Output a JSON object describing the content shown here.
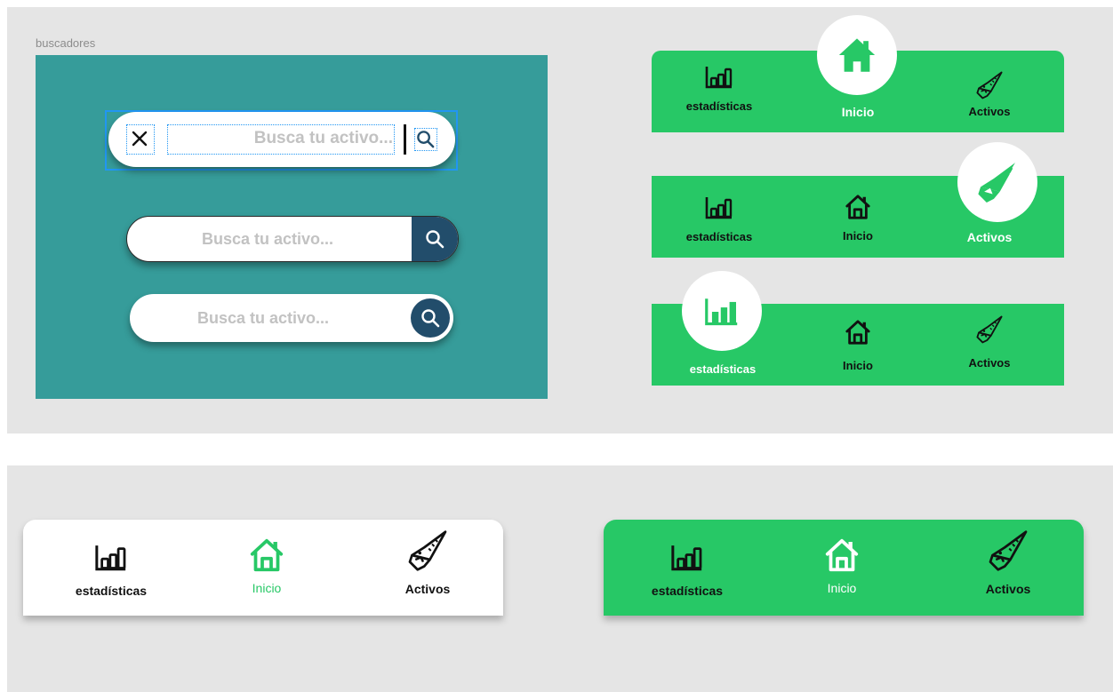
{
  "frame_title": "buscadores",
  "search": {
    "placeholder_1": "Busca tu activo...",
    "placeholder_2": "Busca tu activo...",
    "placeholder_3": "Busca tu activo..."
  },
  "nav": {
    "stats": "estadísticas",
    "home": "Inicio",
    "assets": "Activos"
  },
  "colors": {
    "green": "#27c866",
    "teal": "#369c9a",
    "navy": "#224d6b",
    "selection": "#2196f3"
  },
  "icons": [
    "close-icon",
    "search-icon",
    "bar-chart-icon",
    "home-icon",
    "saw-icon"
  ]
}
